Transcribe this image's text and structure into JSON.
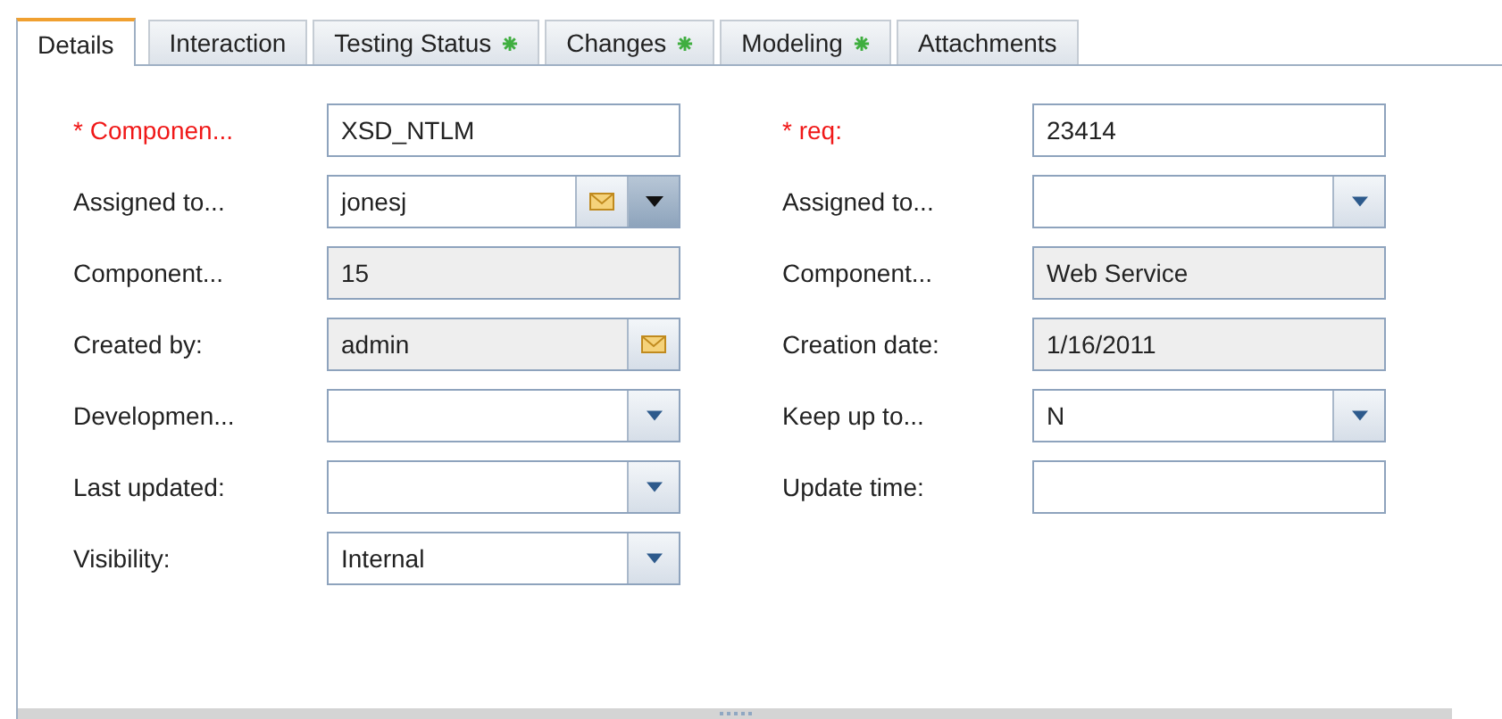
{
  "tabs": [
    {
      "label": "Details",
      "selected": true,
      "modified": false
    },
    {
      "label": "Interaction",
      "selected": false,
      "modified": false
    },
    {
      "label": "Testing Status",
      "selected": false,
      "modified": true
    },
    {
      "label": "Changes",
      "selected": false,
      "modified": true
    },
    {
      "label": "Modeling",
      "selected": false,
      "modified": true
    },
    {
      "label": "Attachments",
      "selected": false,
      "modified": false
    }
  ],
  "fields": [
    {
      "label": "* Componen...",
      "required": true,
      "kind": "text",
      "value": "XSD_NTLM",
      "readonly": false
    },
    {
      "label": "* req:",
      "required": true,
      "kind": "text",
      "value": "23414",
      "readonly": false
    },
    {
      "label": "Assigned to...",
      "required": false,
      "kind": "user",
      "value": "jonesj",
      "readonly": false
    },
    {
      "label": "Assigned to...",
      "required": false,
      "kind": "combo",
      "readonly": false
    },
    {
      "label": "Component...",
      "required": false,
      "kind": "text",
      "value": "15",
      "readonly": true
    },
    {
      "label": "Component...",
      "required": false,
      "kind": "text",
      "value": "Web Service",
      "readonly": true
    },
    {
      "label": "Created by:",
      "required": false,
      "kind": "mail",
      "value": "admin",
      "readonly": true
    },
    {
      "label": "Creation date:",
      "required": false,
      "kind": "text",
      "value": "1/16/2011",
      "readonly": true
    },
    {
      "label": "Developmen...",
      "required": false,
      "kind": "combo",
      "readonly": false
    },
    {
      "label": "Keep up to...",
      "required": false,
      "kind": "combo",
      "value": "N",
      "readonly": false
    },
    {
      "label": "Last updated:",
      "required": false,
      "kind": "combo",
      "readonly": false
    },
    {
      "label": "Update time:",
      "required": false,
      "kind": "text",
      "readonly": false
    },
    {
      "label": "Visibility:",
      "required": false,
      "kind": "combo",
      "value": "Internal",
      "readonly": false
    }
  ]
}
